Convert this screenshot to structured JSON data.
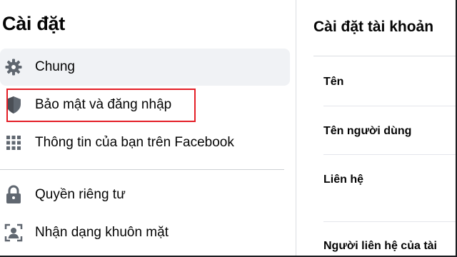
{
  "sidebar": {
    "title": "Cài đặt",
    "items": [
      {
        "label": "Chung",
        "icon": "gear-icon"
      },
      {
        "label": "Bảo mật và đăng nhập",
        "icon": "shield-icon"
      },
      {
        "label": "Thông tin của bạn trên Facebook",
        "icon": "grid-icon"
      },
      {
        "label": "Quyền riêng tư",
        "icon": "lock-icon"
      },
      {
        "label": "Nhận dạng khuôn mặt",
        "icon": "face-recognition-icon"
      }
    ]
  },
  "main": {
    "title": "Cài đặt tài khoản",
    "rows": [
      {
        "label": "Tên"
      },
      {
        "label": "Tên người dùng"
      },
      {
        "label": "Liên hệ"
      },
      {
        "label": "Người liên hệ của tài"
      }
    ]
  },
  "colors": {
    "highlight": "#e41e26",
    "active_bg": "#f0f2f5",
    "icon": "#606770"
  }
}
